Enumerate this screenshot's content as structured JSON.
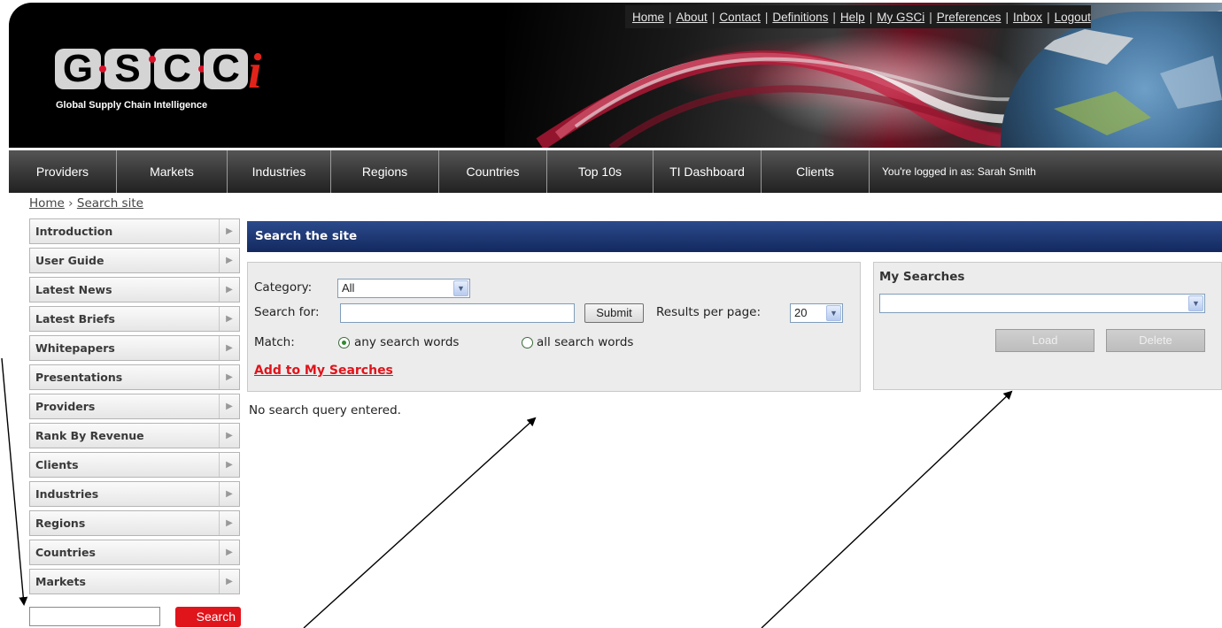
{
  "header": {
    "logo_text": "GSCi",
    "logo_tagline": "Global Supply Chain Intelligence",
    "top_links": [
      "Home",
      "About",
      "Contact",
      "Definitions",
      "Help",
      "My GSCi",
      "Preferences",
      "Inbox",
      "Logout"
    ]
  },
  "nav": {
    "items": [
      "Providers",
      "Markets",
      "Industries",
      "Regions",
      "Countries",
      "Top 10s",
      "TI Dashboard",
      "Clients"
    ],
    "user_label": "You're logged in as: Sarah Smith"
  },
  "breadcrumb": {
    "home": "Home",
    "separator": "›",
    "current": "Search site"
  },
  "sidebar": {
    "items": [
      "Introduction",
      "User Guide",
      "Latest News",
      "Latest Briefs",
      "Whitepapers",
      "Presentations",
      "Providers",
      "Rank By Revenue",
      "Clients",
      "Industries",
      "Regions",
      "Countries",
      "Markets"
    ],
    "search_value": "",
    "search_button": "Search"
  },
  "main": {
    "title": "Search the site",
    "category_label": "Category:",
    "category_value": "All",
    "search_for_label": "Search for:",
    "search_for_value": "",
    "submit_label": "Submit",
    "results_per_page_label": "Results per page:",
    "results_per_page_value": "20",
    "match_label": "Match:",
    "match_any_label": "any search words",
    "match_all_label": "all search words",
    "match_selected": "any",
    "add_to_searches": "Add to My Searches",
    "status_message": "No search query entered."
  },
  "my_searches": {
    "title": "My Searches",
    "selected_value": "",
    "load_label": "Load",
    "delete_label": "Delete"
  },
  "colors": {
    "header_bg": "#000000",
    "nav_bg": "#3c3c3c",
    "title_bar_blue": "#1b3570",
    "accent_red": "#e0141b",
    "panel_bg": "#ececec"
  },
  "icons": [
    "chevron-right-icon",
    "dropdown-arrow-icon",
    "radio-checked-icon",
    "radio-unchecked-icon",
    "annotation-arrow-icon"
  ]
}
